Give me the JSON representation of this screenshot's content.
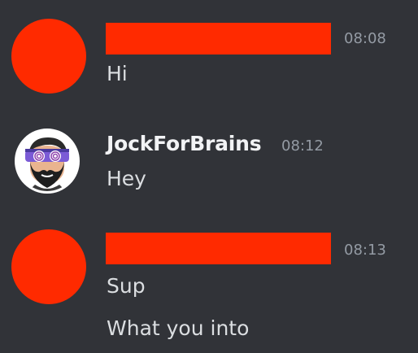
{
  "messages": [
    {
      "author": "",
      "author_redacted": true,
      "timestamp": "08:08",
      "lines": [
        "Hi"
      ]
    },
    {
      "author": "JockForBrains",
      "author_redacted": false,
      "timestamp": "08:12",
      "lines": [
        "Hey"
      ]
    },
    {
      "author": "",
      "author_redacted": true,
      "timestamp": "08:13",
      "lines": [
        "Sup",
        "What you into"
      ]
    }
  ],
  "colors": {
    "background": "#313338",
    "redaction": "#ff2a00",
    "timestamp": "#949ba4",
    "username": "#f2f3f5",
    "message_text": "#dbdee1"
  },
  "icons": {
    "user_avatar": "bearded-man-hypno-glasses-avatar"
  }
}
